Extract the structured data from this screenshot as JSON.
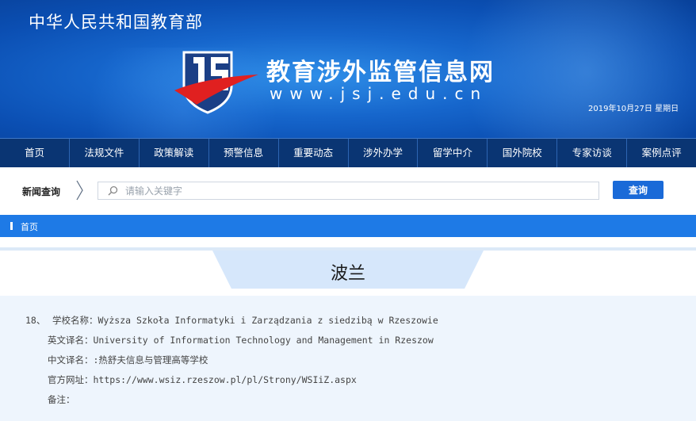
{
  "header": {
    "ministry": "中华人民共和国教育部",
    "site_title": "教育涉外监管信息网",
    "site_url": "www.jsj.edu.cn",
    "date": "2019年10月27日  星期日"
  },
  "nav": {
    "items": [
      {
        "label": "首页"
      },
      {
        "label": "法规文件"
      },
      {
        "label": "政策解读"
      },
      {
        "label": "预警信息"
      },
      {
        "label": "重要动态"
      },
      {
        "label": "涉外办学"
      },
      {
        "label": "留学中介"
      },
      {
        "label": "国外院校"
      },
      {
        "label": "专家访谈"
      },
      {
        "label": "案例点评"
      }
    ]
  },
  "search": {
    "label": "新闻查询",
    "placeholder": "请输入关键字",
    "button": "查询"
  },
  "breadcrumb": {
    "home": "首页"
  },
  "country": {
    "name": "波兰"
  },
  "entry": {
    "number": "18、",
    "school_name": "学校名称：Wyższa Szkoła Informatyki i Zarządzania z siedzibą w Rzeszowie",
    "english_name": "英文译名：University of Information Technology and Management in Rzeszow",
    "chinese_name": "中文译名：:热舒夫信息与管理高等学校",
    "website": "官方网址：https://www.wsiz.rzeszow.pl/pl/Strony/WSIiZ.aspx",
    "remark": "备注："
  },
  "colors": {
    "nav_bg": "#0a3573",
    "accent": "#1e7ae6",
    "button": "#1a6ad8",
    "content_bg": "#eef5fd"
  }
}
